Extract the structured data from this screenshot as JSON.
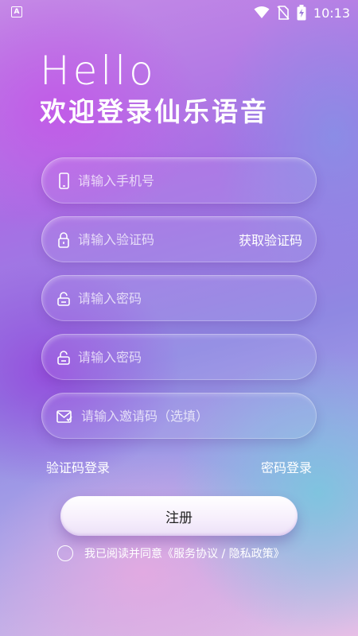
{
  "status_bar": {
    "left_icon": "A",
    "time": "10:13",
    "icons": [
      "wifi-icon",
      "no-sim-icon",
      "battery-charging-icon"
    ]
  },
  "heading": {
    "hello": "Hello",
    "welcome": "欢迎登录仙乐语音"
  },
  "form": {
    "phone_placeholder": "请输入手机号",
    "code_placeholder": "请输入验证码",
    "get_code_label": "获取验证码",
    "password_placeholder": "请输入密码",
    "confirm_password_placeholder": "请输入密码",
    "invite_placeholder": "请输入邀请码（选填）"
  },
  "links": {
    "code_login": "验证码登录",
    "password_login": "密码登录"
  },
  "register_label": "注册",
  "agreement": {
    "prefix": "我已阅读并同意",
    "terms": "《服务协议 / 隐私政策》"
  }
}
